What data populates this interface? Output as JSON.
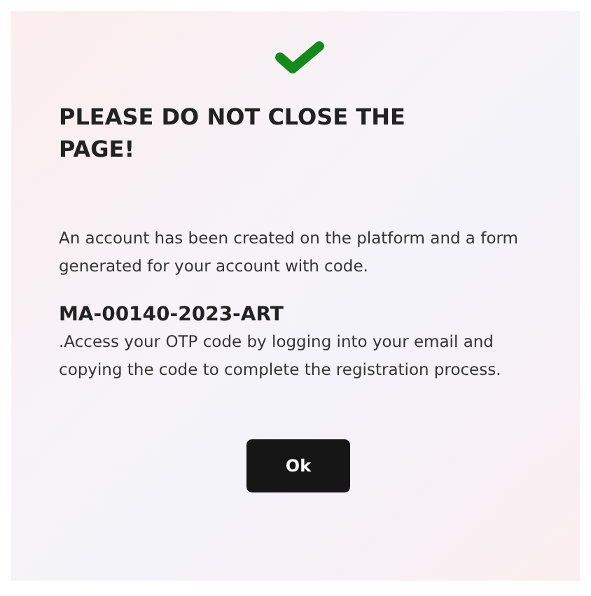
{
  "dialog": {
    "title": "PLEASE DO NOT CLOSE THE PAGE!",
    "message": "An account has been created on the platform and a form generated for your account with code.",
    "code": "MA-00140-2023-ART",
    "instruction": ".Access your OTP code by logging into your email and copying the code to complete the registration process.",
    "button": "Ok"
  }
}
